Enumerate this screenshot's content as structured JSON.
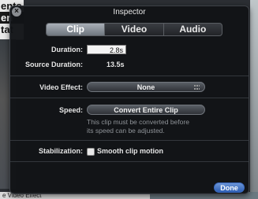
{
  "background": {
    "top_fragment_lines": [
      "ents",
      "en",
      "tat"
    ],
    "bottom_fragment": "e Video Effect"
  },
  "inspector": {
    "title": "Inspector",
    "tabs": [
      {
        "label": "Clip",
        "active": true
      },
      {
        "label": "Video",
        "active": false
      },
      {
        "label": "Audio",
        "active": false
      }
    ],
    "duration_label": "Duration:",
    "duration_value": "2.8s",
    "source_duration_label": "Source Duration:",
    "source_duration_value": "13.5s",
    "video_effect_label": "Video Effect:",
    "video_effect_value": "None",
    "speed_label": "Speed:",
    "convert_button": "Convert Entire Clip",
    "speed_help_line1": "This clip must be converted before",
    "speed_help_line2": "its speed can be adjusted.",
    "stabilization_label": "Stabilization:",
    "stabilization_option": "Smooth clip motion",
    "stabilization_checked": false,
    "done_button": "Done"
  },
  "colors": {
    "panel_bg": "#121417",
    "done_accent": "#2d5fb4",
    "active_tab": "#8e959d"
  }
}
